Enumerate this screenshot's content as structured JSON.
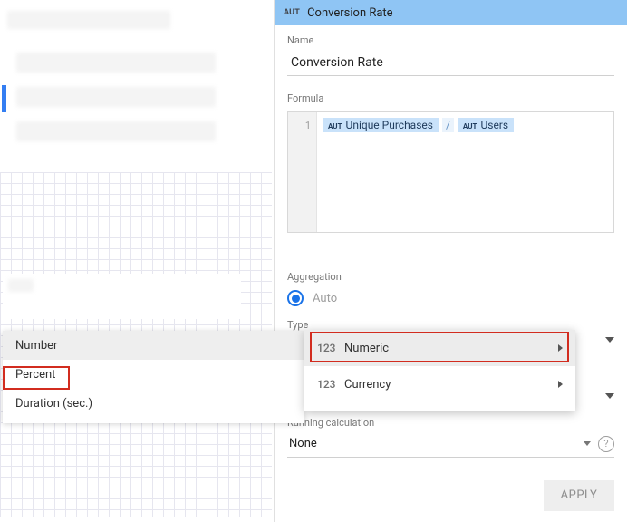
{
  "header": {
    "badge": "AUT",
    "title": "Conversion Rate"
  },
  "name_section": {
    "label": "Name",
    "value": "Conversion Rate"
  },
  "formula_section": {
    "label": "Formula",
    "line_no": "1",
    "token1_badge": "AUT",
    "token1": "Unique Purchases",
    "divider": "/",
    "token2_badge": "AUT",
    "token2": "Users"
  },
  "aggregation": {
    "label": "Aggregation",
    "value": "Auto"
  },
  "type": {
    "label": "Type"
  },
  "type_menu": {
    "items": [
      {
        "icon": "123",
        "label": "Numeric"
      },
      {
        "icon": "123",
        "label": "Currency"
      }
    ]
  },
  "number_menu": {
    "items": [
      "Number",
      "Percent",
      "Duration (sec.)"
    ]
  },
  "running": {
    "label": "Running calculation",
    "value": "None"
  },
  "apply": "APPLY",
  "help": "?"
}
